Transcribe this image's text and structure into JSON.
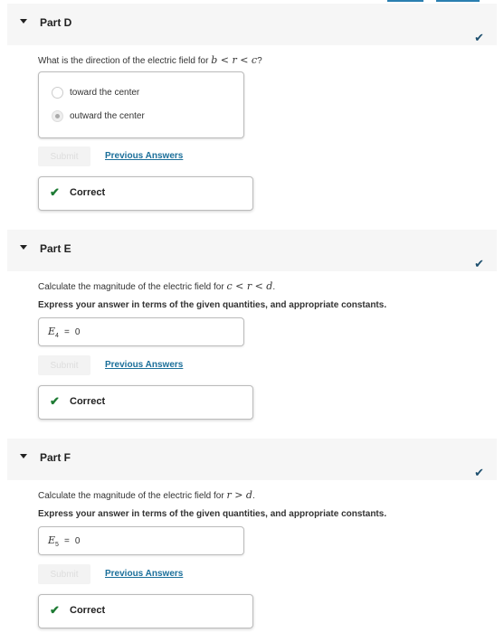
{
  "parts": [
    {
      "title": "Part D",
      "question_prefix": "What is the direction of the electric field for ",
      "question_math": "b < r < c",
      "question_suffix": "?",
      "choices": [
        {
          "label": "toward the center",
          "selected": false
        },
        {
          "label": "outward the center",
          "selected": true
        }
      ],
      "submit_label": "Submit",
      "previous_answers_label": "Previous Answers",
      "feedback": "Correct",
      "status": "complete"
    },
    {
      "title": "Part E",
      "question_prefix": "Calculate the magnitude of the electric field for ",
      "question_math": "c < r < d",
      "question_suffix": ".",
      "instruction": "Express your answer in terms of the given quantities, and appropriate constants.",
      "answer_var": "E",
      "answer_sub": "4",
      "answer_eq": "=",
      "answer_value": "0",
      "submit_label": "Submit",
      "previous_answers_label": "Previous Answers",
      "feedback": "Correct",
      "status": "complete"
    },
    {
      "title": "Part F",
      "question_prefix": "Calculate the magnitude of the electric field for ",
      "question_math": "r > d",
      "question_suffix": ".",
      "instruction": "Express your answer in terms of the given quantities, and appropriate constants.",
      "answer_var": "E",
      "answer_sub": "5",
      "answer_eq": "=",
      "answer_value": "0",
      "submit_label": "Submit",
      "previous_answers_label": "Previous Answers",
      "feedback": "Correct",
      "status": "complete"
    }
  ],
  "icons": {
    "collapse": "▼",
    "check": "✔"
  }
}
